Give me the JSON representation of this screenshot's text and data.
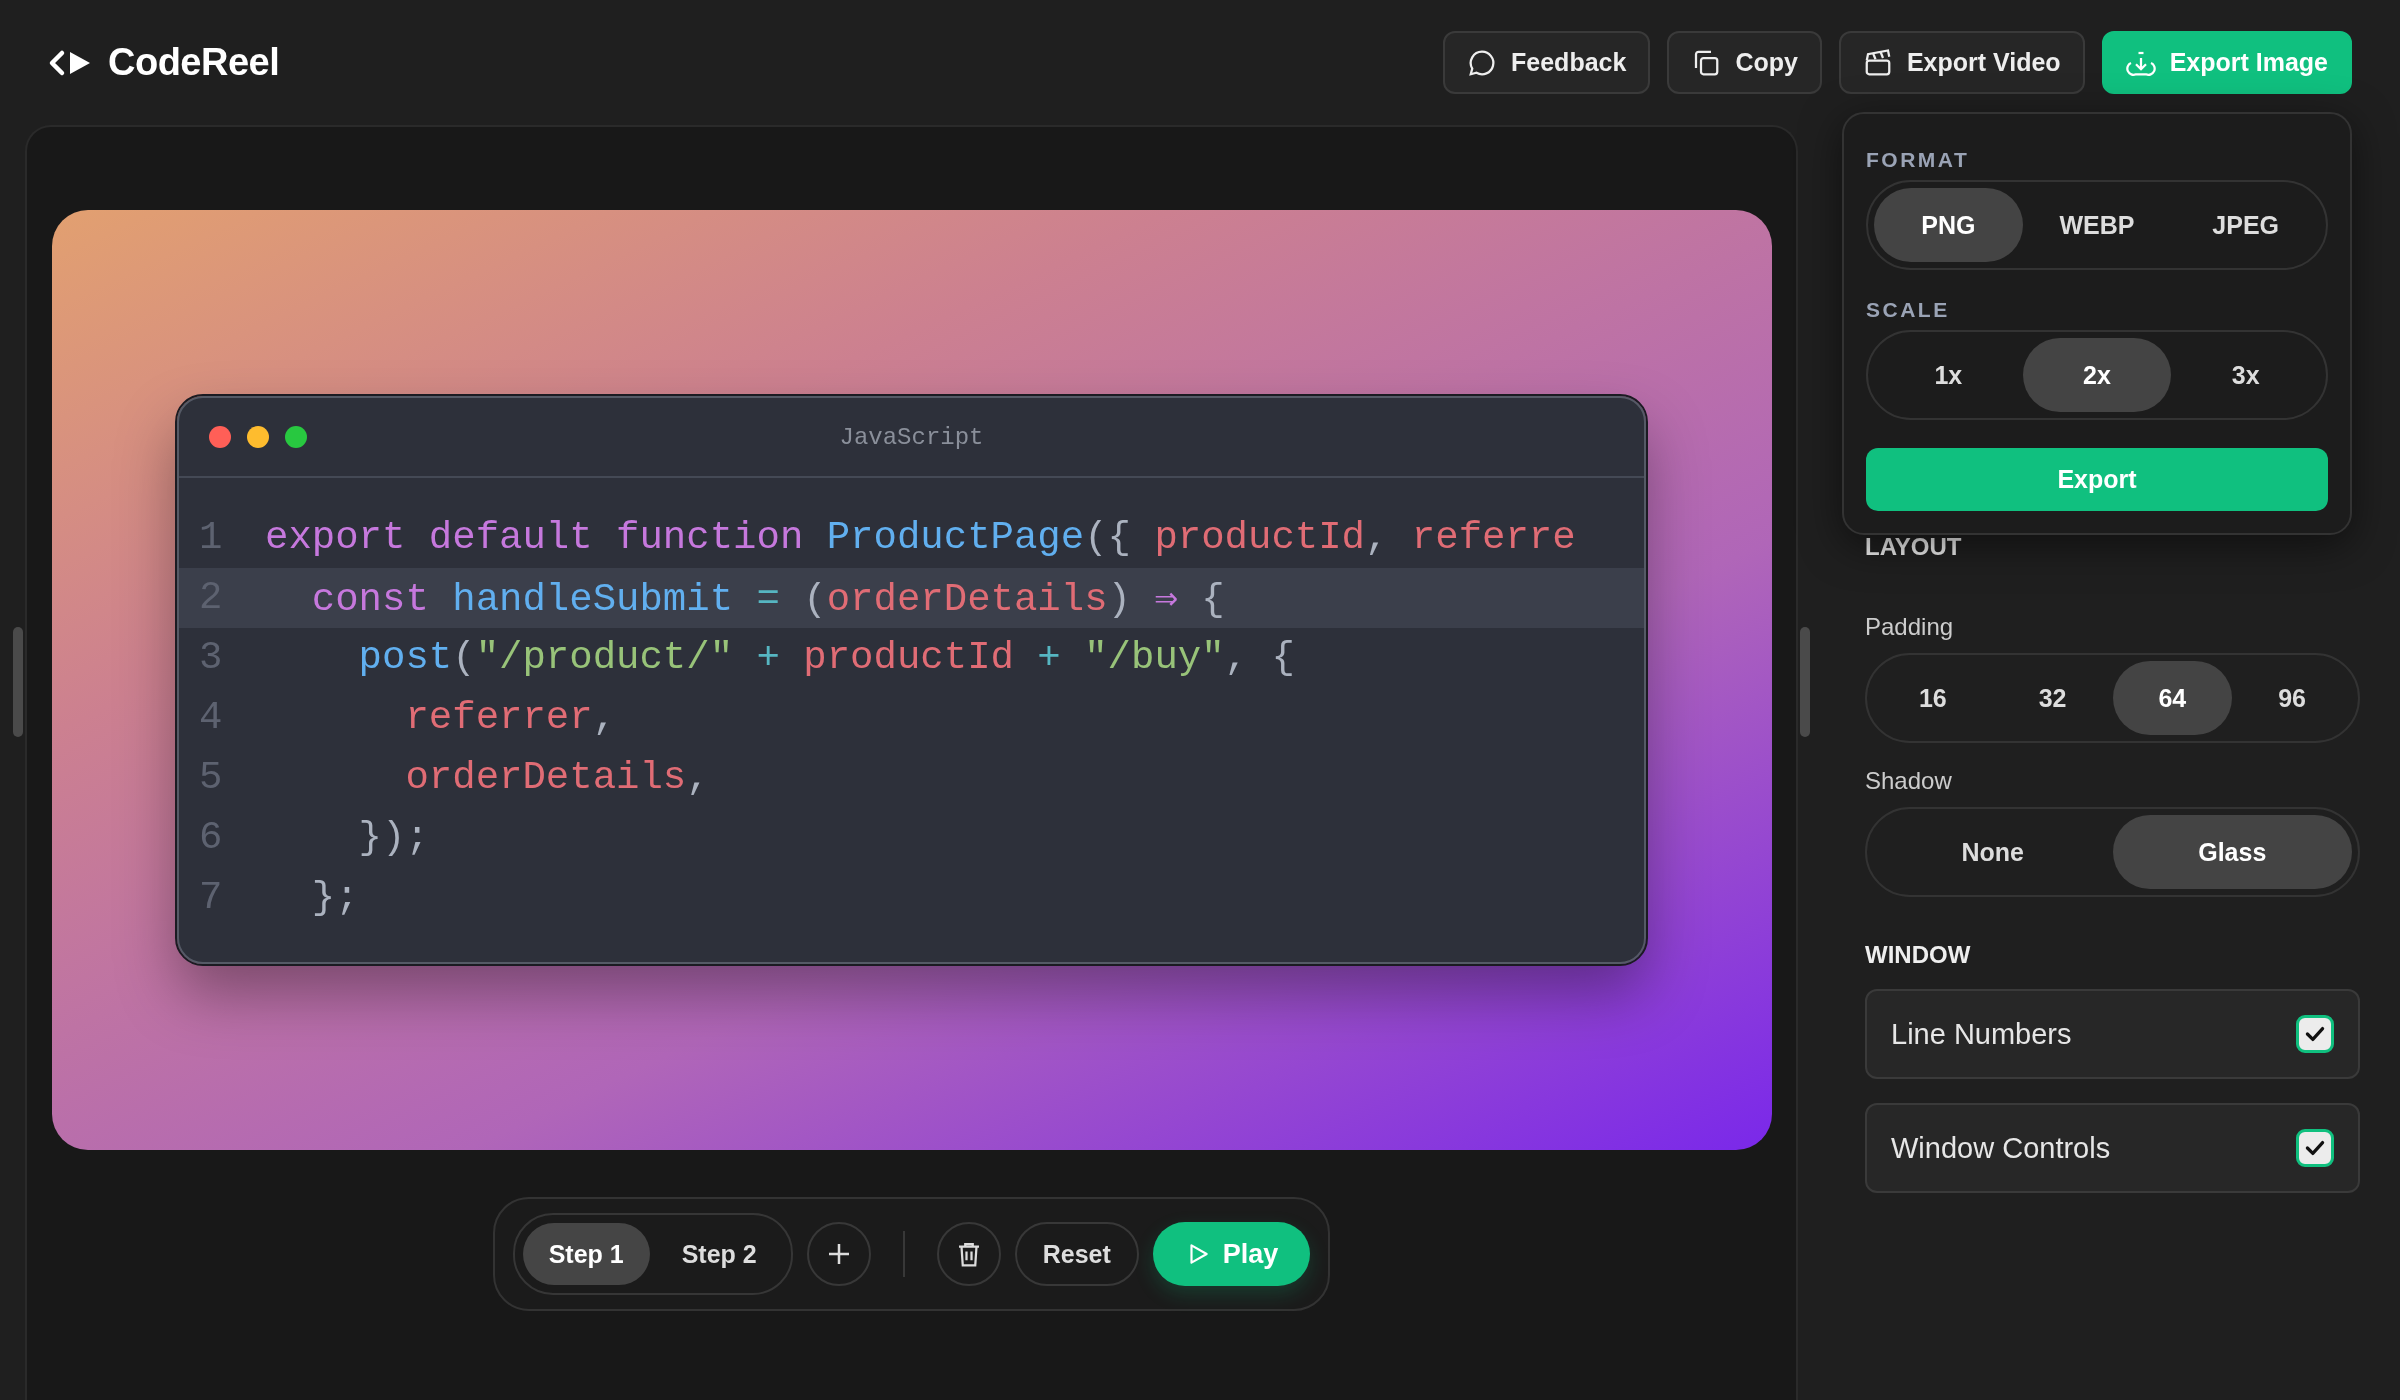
{
  "header": {
    "logo": "CodeReel",
    "buttons": [
      {
        "kind": "feedback",
        "label": "Feedback",
        "primary": false
      },
      {
        "kind": "copy",
        "label": "Copy",
        "primary": false
      },
      {
        "kind": "video",
        "label": "Export Video",
        "primary": false
      },
      {
        "kind": "image",
        "label": "Export Image",
        "primary": true
      }
    ]
  },
  "editor": {
    "title": "JavaScript",
    "lines": [
      {
        "number": "1",
        "highlighted": false,
        "tokens": [
          {
            "kind": "keyword",
            "text": "export default function "
          },
          {
            "kind": "function",
            "text": "ProductPage"
          },
          {
            "kind": "punct",
            "text": "({ "
          },
          {
            "kind": "variable",
            "text": "productId"
          },
          {
            "kind": "punct",
            "text": ", "
          },
          {
            "kind": "variable",
            "text": "referre"
          }
        ]
      },
      {
        "number": "2",
        "highlighted": true,
        "tokens": [
          {
            "kind": "keyword",
            "text": "  const "
          },
          {
            "kind": "function",
            "text": "handleSubmit"
          },
          {
            "kind": "operator",
            "text": " = "
          },
          {
            "kind": "punct",
            "text": "("
          },
          {
            "kind": "variable",
            "text": "orderDetails"
          },
          {
            "kind": "punct",
            "text": ") "
          },
          {
            "kind": "keyword",
            "text": "⇒"
          },
          {
            "kind": "punct",
            "text": " {"
          }
        ]
      },
      {
        "number": "3",
        "highlighted": false,
        "tokens": [
          {
            "kind": "function",
            "text": "    post"
          },
          {
            "kind": "punct",
            "text": "("
          },
          {
            "kind": "string",
            "text": "\"/product/\""
          },
          {
            "kind": "operator",
            "text": " + "
          },
          {
            "kind": "variable",
            "text": "productId"
          },
          {
            "kind": "operator",
            "text": " + "
          },
          {
            "kind": "string",
            "text": "\"/buy\""
          },
          {
            "kind": "punct",
            "text": ", {"
          }
        ]
      },
      {
        "number": "4",
        "highlighted": false,
        "tokens": [
          {
            "kind": "variable",
            "text": "      referrer"
          },
          {
            "kind": "punct",
            "text": ","
          }
        ]
      },
      {
        "number": "5",
        "highlighted": false,
        "tokens": [
          {
            "kind": "variable",
            "text": "      orderDetails"
          },
          {
            "kind": "punct",
            "text": ","
          }
        ]
      },
      {
        "number": "6",
        "highlighted": false,
        "tokens": [
          {
            "kind": "punct",
            "text": "    });"
          }
        ]
      },
      {
        "number": "7",
        "highlighted": false,
        "tokens": [
          {
            "kind": "punct",
            "text": "  };"
          }
        ]
      }
    ]
  },
  "toolbar": {
    "steps": [
      {
        "label": "Step 1",
        "selected": true
      },
      {
        "label": "Step 2",
        "selected": false
      }
    ],
    "reset": "Reset",
    "play": "Play"
  },
  "export_popover": {
    "groups": [
      {
        "label": "FORMAT",
        "options": [
          {
            "label": "PNG",
            "selected": true
          },
          {
            "label": "WEBP",
            "selected": false
          },
          {
            "label": "JPEG",
            "selected": false
          }
        ]
      },
      {
        "label": "SCALE",
        "options": [
          {
            "label": "1x",
            "selected": false
          },
          {
            "label": "2x",
            "selected": true
          },
          {
            "label": "3x",
            "selected": false
          }
        ]
      }
    ],
    "button": "Export"
  },
  "settings": {
    "section": "LAYOUT",
    "groups": [
      {
        "label": "Padding",
        "options": [
          {
            "label": "16",
            "selected": false
          },
          {
            "label": "32",
            "selected": false
          },
          {
            "label": "64",
            "selected": true
          },
          {
            "label": "96",
            "selected": false
          }
        ]
      },
      {
        "label": "Shadow",
        "options": [
          {
            "label": "None",
            "selected": false
          },
          {
            "label": "Glass",
            "selected": true
          }
        ]
      }
    ],
    "window_section": "WINDOW",
    "toggles": [
      {
        "label": "Line Numbers",
        "checked": true
      },
      {
        "label": "Window Controls",
        "checked": true
      }
    ]
  }
}
